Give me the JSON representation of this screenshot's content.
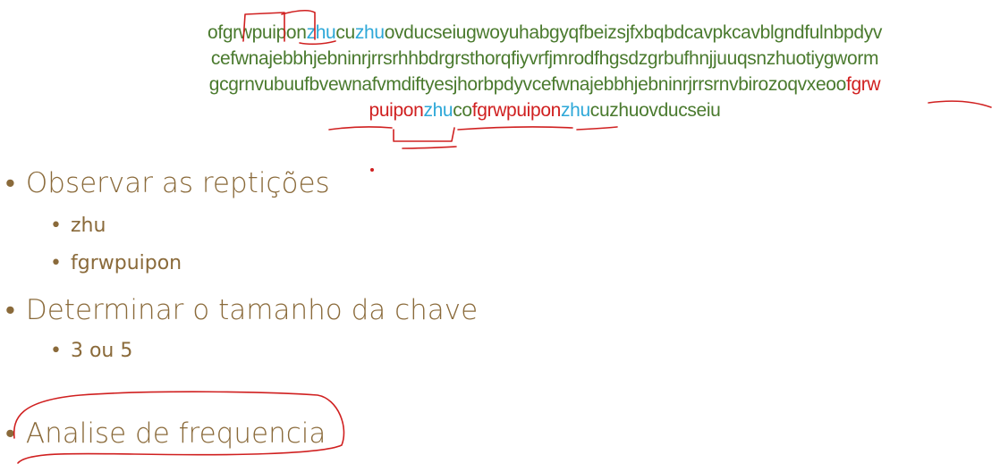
{
  "cipher_text": {
    "line1": [
      {
        "text": "ofgrwpuipon",
        "color": "green"
      },
      {
        "text": "zhu",
        "color": "blue"
      },
      {
        "text": "cu",
        "color": "green"
      },
      {
        "text": "zhu",
        "color": "blue"
      },
      {
        "text": "ovducseiugwoyuhabgyqfbeizsjfxbqbdcavpkcavblgndfulnbpdyv",
        "color": "green"
      }
    ],
    "line2": [
      {
        "text": "cefwnajebbhjebninrjrrsrhhbdrgrsthorqfiyvrfjmrodfhgsdzgrbufhnjjuuqsnzhuotiygworm",
        "color": "green"
      }
    ],
    "line3": [
      {
        "text": "gcgrnvubuufbvewnafvmdiftyesjhorbpdyvcefwnajebbhjebninrjrrsrnvbirozoqvxeoo",
        "color": "green"
      },
      {
        "text": "fgrw",
        "color": "red"
      }
    ],
    "line4": [
      {
        "text": "puipon",
        "color": "red"
      },
      {
        "text": "zhu",
        "color": "blue"
      },
      {
        "text": "co",
        "color": "green"
      },
      {
        "text": "fgrwpuipon",
        "color": "red"
      },
      {
        "text": "zhu",
        "color": "blue"
      },
      {
        "text": "cuzhuovducseiu",
        "color": "green"
      }
    ]
  },
  "bullets": {
    "b1": "Observar as reptições",
    "b1_sub1": "zhu",
    "b1_sub2": "fgrwpuipon",
    "b2": "Determinar o tamanho da chave",
    "b2_sub1": "3 ou 5",
    "b3": "Analise de frequencia",
    "marker": "•"
  },
  "colors": {
    "cipher_green": "#4a7a2e",
    "highlight_blue": "#2ea8d8",
    "highlight_red": "#d02020",
    "bullet_text": "#8a6a3a",
    "ink_annotation": "#d02020"
  }
}
